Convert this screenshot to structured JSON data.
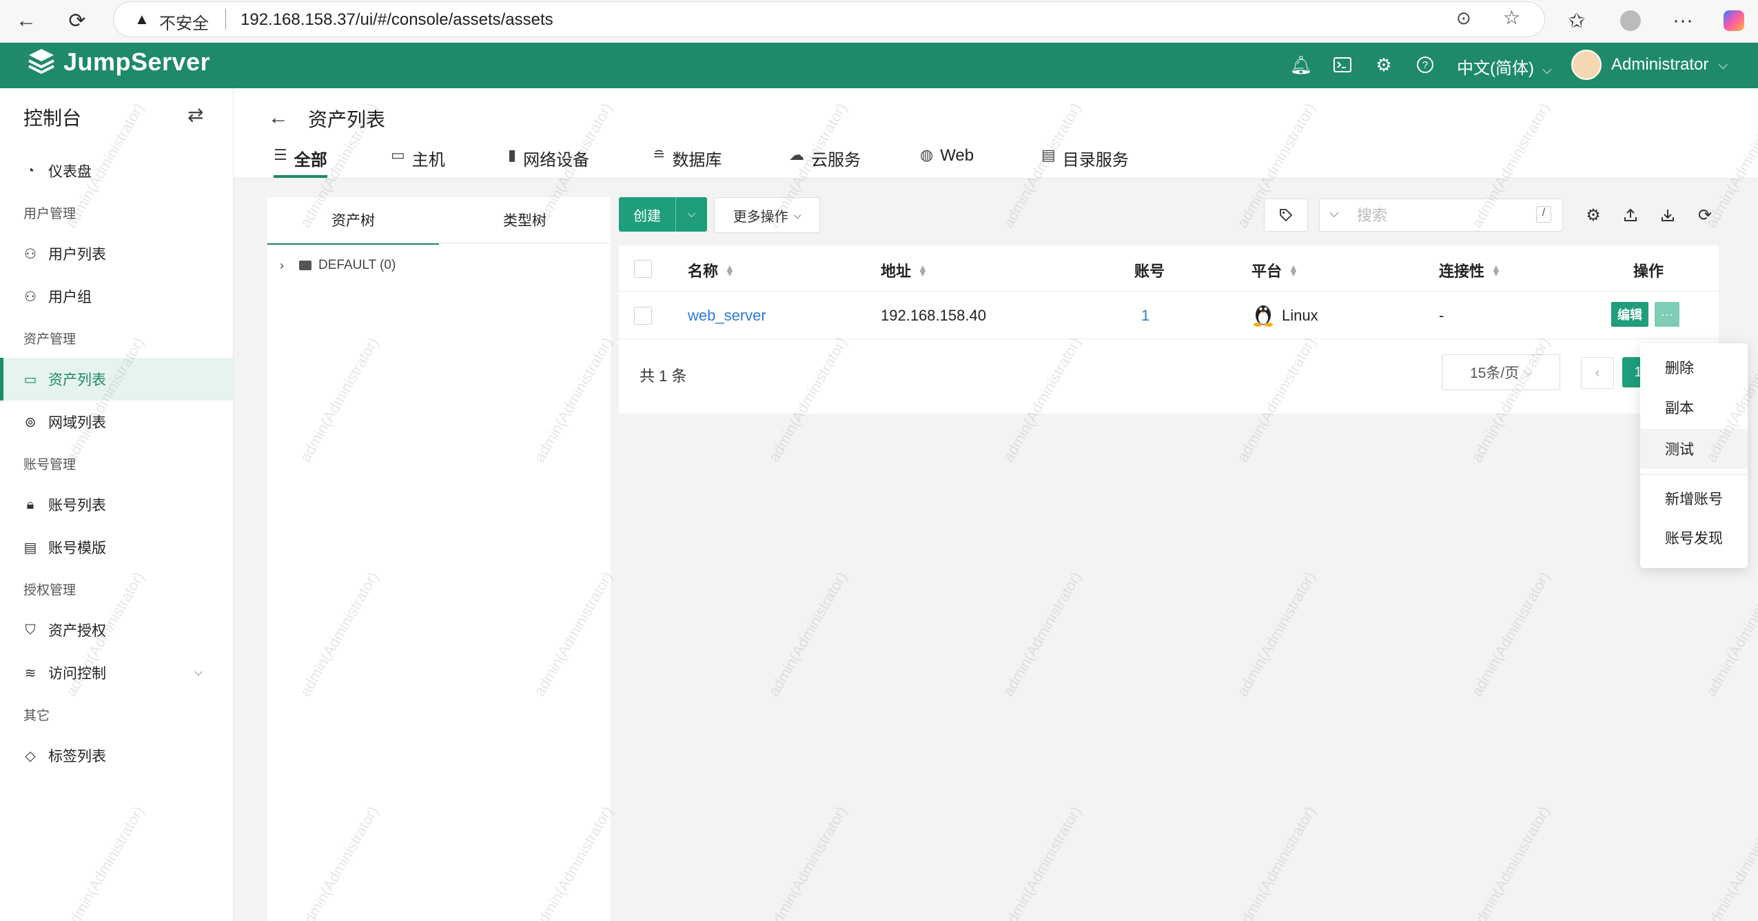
{
  "browser": {
    "security_label": "不安全",
    "url": "192.168.158.37/ui/#/console/assets/assets"
  },
  "app": {
    "brand": "JumpServer",
    "language": "中文(简体)",
    "user": "Administrator",
    "brand_color": "#1e8a6a"
  },
  "sidebar": {
    "title": "控制台",
    "items": [
      {
        "type": "item",
        "label": "仪表盘",
        "icon": "dashboard-icon"
      },
      {
        "type": "group",
        "label": "用户管理"
      },
      {
        "type": "item",
        "label": "用户列表",
        "icon": "user-icon"
      },
      {
        "type": "item",
        "label": "用户组",
        "icon": "user-group-icon"
      },
      {
        "type": "group",
        "label": "资产管理"
      },
      {
        "type": "item",
        "label": "资产列表",
        "icon": "monitor-icon",
        "active": true
      },
      {
        "type": "item",
        "label": "网域列表",
        "icon": "location-icon"
      },
      {
        "type": "group",
        "label": "账号管理"
      },
      {
        "type": "item",
        "label": "账号列表",
        "icon": "lock-icon"
      },
      {
        "type": "item",
        "label": "账号模版",
        "icon": "template-icon"
      },
      {
        "type": "group",
        "label": "授权管理"
      },
      {
        "type": "item",
        "label": "资产授权",
        "icon": "shield-icon"
      },
      {
        "type": "item",
        "label": "访问控制",
        "icon": "filter-icon",
        "expandable": true
      },
      {
        "type": "group",
        "label": "其它"
      },
      {
        "type": "item",
        "label": "标签列表",
        "icon": "tag-icon"
      }
    ]
  },
  "page": {
    "title": "资产列表",
    "tabs": [
      {
        "label": "全部",
        "icon": "list-icon",
        "active": true
      },
      {
        "label": "主机",
        "icon": "host-icon"
      },
      {
        "label": "网络设备",
        "icon": "network-device-icon"
      },
      {
        "label": "数据库",
        "icon": "database-icon"
      },
      {
        "label": "云服务",
        "icon": "cloud-icon"
      },
      {
        "label": "Web",
        "icon": "globe-icon"
      },
      {
        "label": "目录服务",
        "icon": "directory-icon"
      }
    ]
  },
  "tree": {
    "tabs": [
      "资产树",
      "类型树"
    ],
    "node": "DEFAULT (0)"
  },
  "toolbar": {
    "create": "创建",
    "more": "更多操作",
    "search_placeholder": "搜索",
    "shortcut": "/"
  },
  "table": {
    "columns": [
      "名称",
      "地址",
      "账号",
      "平台",
      "连接性",
      "操作"
    ],
    "rows": [
      {
        "name": "web_server",
        "address": "192.168.158.40",
        "accounts": "1",
        "platform": "Linux",
        "connectivity": "-",
        "edit": "编辑",
        "more": "···"
      }
    ],
    "total": "共 1 条",
    "page_size": "15条/页",
    "current_page": "1"
  },
  "menu": {
    "items": [
      "删除",
      "副本",
      "测试",
      "新增账号",
      "账号发现"
    ]
  },
  "watermark": "admin(Administrator)"
}
